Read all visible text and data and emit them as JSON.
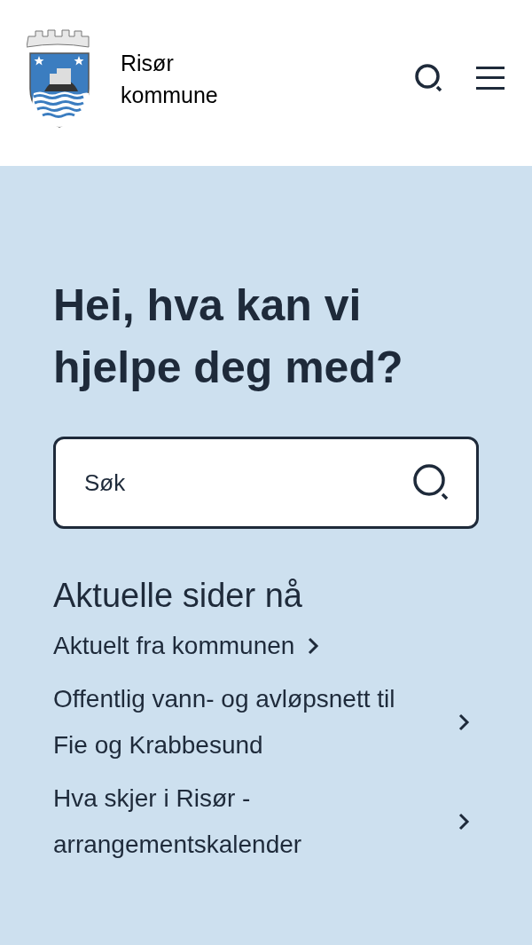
{
  "header": {
    "logo_line_1": "Risør",
    "logo_line_2": "kommune"
  },
  "hero": {
    "heading": "Hei, hva kan vi hjelpe deg med?",
    "search": {
      "placeholder": "Søk"
    }
  },
  "current_pages": {
    "title": "Aktuelle sider nå",
    "links": [
      {
        "label": "Aktuelt fra kommunen"
      },
      {
        "label": "Offentlig vann- og avløpsnett til Fie og Krabbesund"
      },
      {
        "label": "Hva skjer i Risør - arrangementskalender"
      }
    ]
  }
}
